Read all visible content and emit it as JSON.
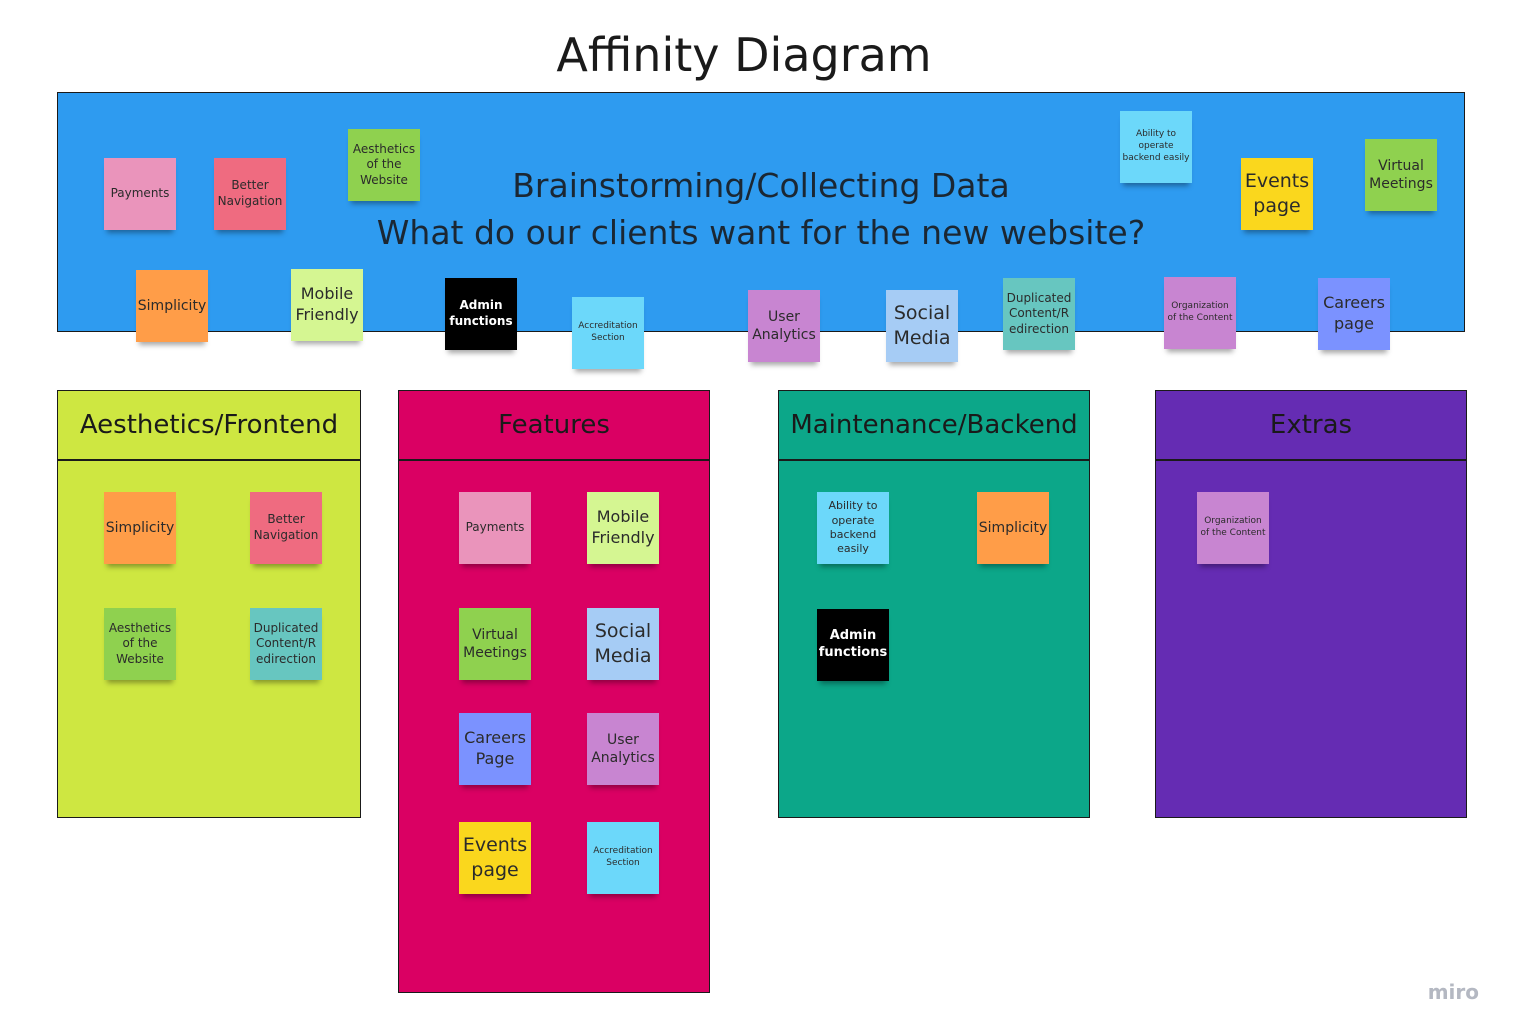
{
  "title": "Affinity Diagram",
  "colors": {
    "board": "#2e9bf0",
    "aesthetics_frame": "#cee741",
    "features_frame": "#da0063",
    "maintenance_frame": "#0ca789",
    "extras_frame": "#652cb3",
    "pink": "#ea94bb",
    "red": "#ef6b80",
    "green": "#8fd14f",
    "orange": "#ff9d48",
    "lime": "#d5f692",
    "black": "#000000",
    "sky": "#6cd8fa",
    "purple": "#c885d1",
    "lightblue": "#a6ccf5",
    "teal": "#67c6c0",
    "yellow": "#fad71d",
    "violet": "#7b92ff"
  },
  "board": {
    "line1": "Brainstorming/Collecting Data",
    "line2": "What do our clients want for the new website?",
    "notes": [
      "Payments",
      "Better Navigation",
      "Aesthetics of the Website",
      "Ability to operate backend easily",
      "Events page",
      "Virtual Meetings",
      "Simplicity",
      "Mobile Friendly",
      "Admin functions",
      "Accreditation Section",
      "User Analytics",
      "Social Media",
      "Duplicated Content/R edirection",
      "Organization of the Content",
      "Careers page"
    ]
  },
  "frames": [
    {
      "title": "Aesthetics/Frontend",
      "notes": [
        "Simplicity",
        "Better Navigation",
        "Aesthetics of the Website",
        "Duplicated Content/R edirection"
      ]
    },
    {
      "title": "Features",
      "notes": [
        "Payments",
        "Mobile Friendly",
        "Virtual Meetings",
        "Social Media",
        "Careers Page",
        "User Analytics",
        "Events page",
        "Accreditation Section"
      ]
    },
    {
      "title": "Maintenance/Backend",
      "notes": [
        "Ability to operate backend easily",
        "Simplicity",
        "Admin functions"
      ]
    },
    {
      "title": "Extras",
      "notes": [
        "Organization of the Content"
      ]
    }
  ],
  "watermark": "miro"
}
